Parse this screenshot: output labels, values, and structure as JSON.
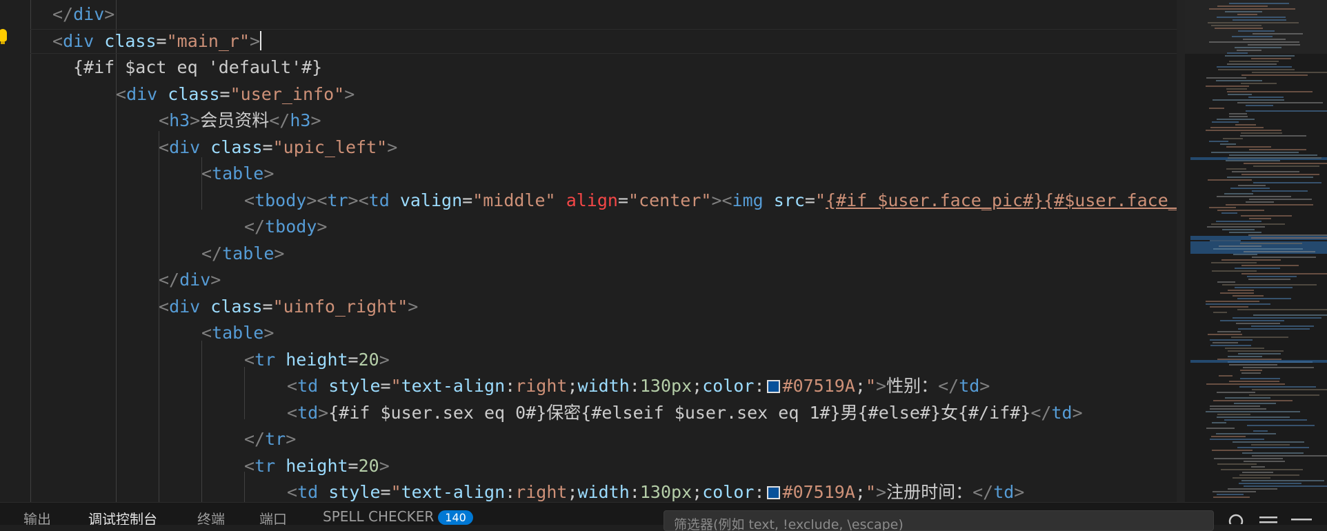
{
  "editor": {
    "lines": [
      [
        {
          "c": "tag-p",
          "t": "</"
        },
        {
          "c": "tag",
          "t": "div"
        },
        {
          "c": "tag-p",
          "t": ">"
        }
      ],
      [
        {
          "c": "tag-p",
          "t": "<"
        },
        {
          "c": "tag",
          "t": "div"
        },
        {
          "c": "txt",
          "t": " "
        },
        {
          "c": "attr",
          "t": "class"
        },
        {
          "c": "txt",
          "t": "="
        },
        {
          "c": "str",
          "t": "\"main_r\""
        },
        {
          "c": "tag-p",
          "t": ">"
        }
      ],
      [
        {
          "c": "txt",
          "t": "{#if $act eq 'default'#}"
        }
      ],
      [
        {
          "c": "tag-p",
          "t": "<"
        },
        {
          "c": "tag",
          "t": "div"
        },
        {
          "c": "txt",
          "t": " "
        },
        {
          "c": "attr",
          "t": "class"
        },
        {
          "c": "txt",
          "t": "="
        },
        {
          "c": "str",
          "t": "\"user_info\""
        },
        {
          "c": "tag-p",
          "t": ">"
        }
      ],
      [
        {
          "c": "tag-p",
          "t": "<"
        },
        {
          "c": "tag",
          "t": "h3"
        },
        {
          "c": "tag-p",
          "t": ">"
        },
        {
          "c": "txt",
          "t": "会员资料"
        },
        {
          "c": "tag-p",
          "t": "</"
        },
        {
          "c": "tag",
          "t": "h3"
        },
        {
          "c": "tag-p",
          "t": ">"
        }
      ],
      [
        {
          "c": "tag-p",
          "t": "<"
        },
        {
          "c": "tag",
          "t": "div"
        },
        {
          "c": "txt",
          "t": " "
        },
        {
          "c": "attr",
          "t": "class"
        },
        {
          "c": "txt",
          "t": "="
        },
        {
          "c": "str",
          "t": "\"upic_left\""
        },
        {
          "c": "tag-p",
          "t": ">"
        }
      ],
      [
        {
          "c": "tag-p",
          "t": "<"
        },
        {
          "c": "tag",
          "t": "table"
        },
        {
          "c": "tag-p",
          "t": ">"
        }
      ],
      [
        {
          "c": "tag-p",
          "t": "<"
        },
        {
          "c": "tag",
          "t": "tbody"
        },
        {
          "c": "tag-p",
          "t": "><"
        },
        {
          "c": "tag",
          "t": "tr"
        },
        {
          "c": "tag-p",
          "t": "><"
        },
        {
          "c": "tag",
          "t": "td"
        },
        {
          "c": "txt",
          "t": " "
        },
        {
          "c": "attr",
          "t": "valign"
        },
        {
          "c": "txt",
          "t": "="
        },
        {
          "c": "str",
          "t": "\"middle\""
        },
        {
          "c": "txt",
          "t": " "
        },
        {
          "c": "attr-alt",
          "t": "align"
        },
        {
          "c": "txt",
          "t": "="
        },
        {
          "c": "str",
          "t": "\"center\""
        },
        {
          "c": "tag-p",
          "t": "><"
        },
        {
          "c": "tag",
          "t": "img"
        },
        {
          "c": "txt",
          "t": " "
        },
        {
          "c": "attr",
          "t": "src"
        },
        {
          "c": "txt",
          "t": "="
        },
        {
          "c": "str",
          "t": "\""
        },
        {
          "c": "str ul",
          "t": "{#if $user.face_pic#}{#$user.face_pic#}{#else#}"
        }
      ],
      [
        {
          "c": "tag-p",
          "t": "</"
        },
        {
          "c": "tag",
          "t": "tbody"
        },
        {
          "c": "tag-p",
          "t": ">"
        }
      ],
      [
        {
          "c": "tag-p",
          "t": "</"
        },
        {
          "c": "tag",
          "t": "table"
        },
        {
          "c": "tag-p",
          "t": ">"
        }
      ],
      [
        {
          "c": "tag-p",
          "t": "</"
        },
        {
          "c": "tag",
          "t": "div"
        },
        {
          "c": "tag-p",
          "t": ">"
        }
      ],
      [
        {
          "c": "tag-p",
          "t": "<"
        },
        {
          "c": "tag",
          "t": "div"
        },
        {
          "c": "txt",
          "t": " "
        },
        {
          "c": "attr",
          "t": "class"
        },
        {
          "c": "txt",
          "t": "="
        },
        {
          "c": "str",
          "t": "\"uinfo_right\""
        },
        {
          "c": "tag-p",
          "t": ">"
        }
      ],
      [
        {
          "c": "tag-p",
          "t": "<"
        },
        {
          "c": "tag",
          "t": "table"
        },
        {
          "c": "tag-p",
          "t": ">"
        }
      ],
      [
        {
          "c": "tag-p",
          "t": "<"
        },
        {
          "c": "tag",
          "t": "tr"
        },
        {
          "c": "txt",
          "t": " "
        },
        {
          "c": "attr",
          "t": "height"
        },
        {
          "c": "txt",
          "t": "="
        },
        {
          "c": "num",
          "t": "20"
        },
        {
          "c": "tag-p",
          "t": ">"
        }
      ],
      [
        {
          "c": "tag-p",
          "t": "<"
        },
        {
          "c": "tag",
          "t": "td"
        },
        {
          "c": "txt",
          "t": " "
        },
        {
          "c": "attr",
          "t": "style"
        },
        {
          "c": "txt",
          "t": "="
        },
        {
          "c": "str",
          "t": "\""
        },
        {
          "c": "cssp",
          "t": "text-align"
        },
        {
          "c": "txt",
          "t": ":"
        },
        {
          "c": "cssv",
          "t": "right"
        },
        {
          "c": "txt",
          "t": ";"
        },
        {
          "c": "cssp",
          "t": "width"
        },
        {
          "c": "txt",
          "t": ":"
        },
        {
          "c": "num",
          "t": "130px"
        },
        {
          "c": "txt",
          "t": ";"
        },
        {
          "c": "cssp",
          "t": "color"
        },
        {
          "c": "txt",
          "t": ":"
        },
        {
          "c": "swatch",
          "t": ""
        },
        {
          "c": "cssv",
          "t": "#07519A"
        },
        {
          "c": "txt",
          "t": ";"
        },
        {
          "c": "str",
          "t": "\""
        },
        {
          "c": "tag-p",
          "t": ">"
        },
        {
          "c": "txt",
          "t": "性别："
        },
        {
          "c": "tag-p",
          "t": "</"
        },
        {
          "c": "tag",
          "t": "td"
        },
        {
          "c": "tag-p",
          "t": ">"
        }
      ],
      [
        {
          "c": "tag-p",
          "t": "<"
        },
        {
          "c": "tag",
          "t": "td"
        },
        {
          "c": "tag-p",
          "t": ">"
        },
        {
          "c": "txt",
          "t": "{#if $user.sex eq 0#}保密{#elseif $user.sex eq 1#}男{#else#}女{#/if#}"
        },
        {
          "c": "tag-p",
          "t": "</"
        },
        {
          "c": "tag",
          "t": "td"
        },
        {
          "c": "tag-p",
          "t": ">"
        }
      ],
      [
        {
          "c": "tag-p",
          "t": "</"
        },
        {
          "c": "tag",
          "t": "tr"
        },
        {
          "c": "tag-p",
          "t": ">"
        }
      ],
      [
        {
          "c": "tag-p",
          "t": "<"
        },
        {
          "c": "tag",
          "t": "tr"
        },
        {
          "c": "txt",
          "t": " "
        },
        {
          "c": "attr",
          "t": "height"
        },
        {
          "c": "txt",
          "t": "="
        },
        {
          "c": "num",
          "t": "20"
        },
        {
          "c": "tag-p",
          "t": ">"
        }
      ],
      [
        {
          "c": "tag-p",
          "t": "<"
        },
        {
          "c": "tag",
          "t": "td"
        },
        {
          "c": "txt",
          "t": " "
        },
        {
          "c": "attr",
          "t": "style"
        },
        {
          "c": "txt",
          "t": "="
        },
        {
          "c": "str",
          "t": "\""
        },
        {
          "c": "cssp",
          "t": "text-align"
        },
        {
          "c": "txt",
          "t": ":"
        },
        {
          "c": "cssv",
          "t": "right"
        },
        {
          "c": "txt",
          "t": ";"
        },
        {
          "c": "cssp",
          "t": "width"
        },
        {
          "c": "txt",
          "t": ":"
        },
        {
          "c": "num",
          "t": "130px"
        },
        {
          "c": "txt",
          "t": ";"
        },
        {
          "c": "cssp",
          "t": "color"
        },
        {
          "c": "txt",
          "t": ":"
        },
        {
          "c": "swatch",
          "t": ""
        },
        {
          "c": "cssv",
          "t": "#07519A"
        },
        {
          "c": "txt",
          "t": ";"
        },
        {
          "c": "str",
          "t": "\""
        },
        {
          "c": "tag-p",
          "t": ">"
        },
        {
          "c": "txt",
          "t": "注册时间："
        },
        {
          "c": "tag-p",
          "t": "</"
        },
        {
          "c": "tag",
          "t": "td"
        },
        {
          "c": "tag-p",
          "t": ">"
        }
      ]
    ]
  },
  "panel": {
    "tabs": [
      {
        "label": "输出"
      },
      {
        "label": "调试控制台"
      },
      {
        "label": "终端"
      },
      {
        "label": "端口"
      },
      {
        "label": "SPELL CHECKER",
        "badge": "140"
      }
    ],
    "filter_placeholder": "筛选器(例如 text, !exclude, \\escape)"
  },
  "colors": {
    "background": "#1f1f1f",
    "tag": "#569cd6",
    "attribute": "#9cdcfe",
    "string": "#ce9178",
    "number": "#b5cea8",
    "swatch": "#07519a",
    "badge": "#0078d4"
  }
}
